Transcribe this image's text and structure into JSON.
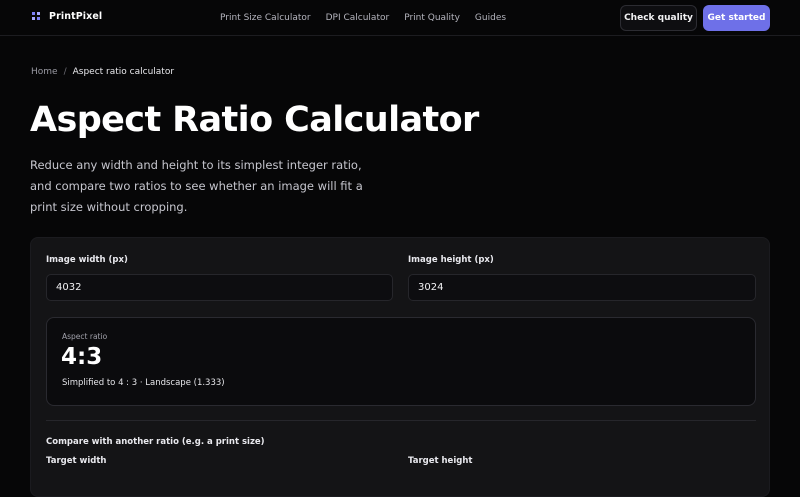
{
  "brand": {
    "name": "PrintPixel"
  },
  "nav": {
    "links": [
      "Print Size Calculator",
      "DPI Calculator",
      "Print Quality",
      "Guides"
    ],
    "check_quality": "Check quality",
    "get_started": "Get started"
  },
  "breadcrumb": {
    "home": "Home",
    "separator": "/",
    "current": "Aspect ratio calculator"
  },
  "hero": {
    "title": "Aspect Ratio Calculator",
    "description": "Reduce any width and height to its simplest integer ratio, and compare two ratios to see whether an image will fit a print size without cropping."
  },
  "calculator": {
    "width_label": "Image width (px)",
    "width_value": "4032",
    "height_label": "Image height (px)",
    "height_value": "3024",
    "result": {
      "label": "Aspect ratio",
      "value": "4:3",
      "detail": "Simplified to 4 : 3 · Landscape (1.333)"
    },
    "compare_title": "Compare with another ratio (e.g. a print size)",
    "target_width_label": "Target width",
    "target_height_label": "Target height"
  },
  "colors": {
    "accent": "#6e70e8",
    "background": "#060607",
    "card": "#141416"
  }
}
